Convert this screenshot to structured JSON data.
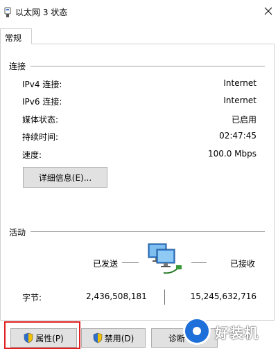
{
  "window": {
    "title": "以太网 3 状态",
    "close_glyph": "✕"
  },
  "tabs": [
    {
      "label": "常规"
    }
  ],
  "connection": {
    "section_label": "连接",
    "rows": [
      {
        "label": "IPv4 连接:",
        "value": "Internet"
      },
      {
        "label": "IPv6 连接:",
        "value": "Internet"
      },
      {
        "label": "媒体状态:",
        "value": "已启用"
      },
      {
        "label": "持续时间:",
        "value": "02:47:45"
      },
      {
        "label": "速度:",
        "value": "100.0 Mbps"
      }
    ],
    "details_button": "详细信息(E)..."
  },
  "activity": {
    "section_label": "活动",
    "sent_label": "已发送",
    "received_label": "已接收",
    "bytes_label": "字节:",
    "bytes_sent": "2,436,508,181",
    "bytes_received": "15,245,632,716"
  },
  "buttons": {
    "properties": "属性(P)",
    "disable": "禁用(D)",
    "diagnose": "诊断"
  },
  "watermark": {
    "text": "好装机"
  },
  "colors": {
    "highlight": "#e02020",
    "watermark_blue": "#1e6fd9",
    "section_line": "#a0a0a0"
  }
}
